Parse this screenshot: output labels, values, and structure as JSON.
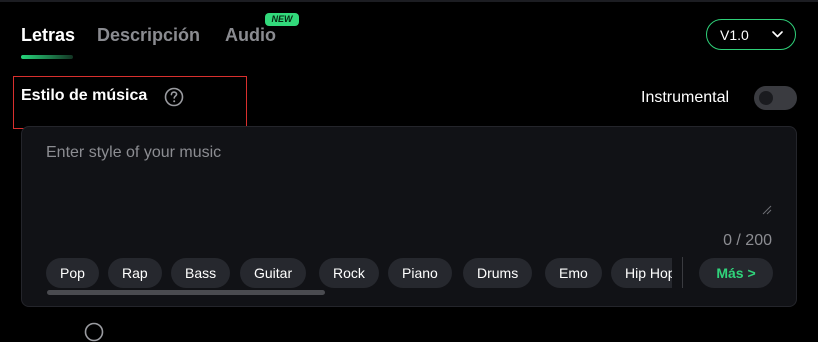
{
  "tabs": [
    {
      "label": "Letras",
      "active": true
    },
    {
      "label": "Descripción",
      "active": false
    },
    {
      "label": "Audio",
      "active": false,
      "badge": "NEW"
    }
  ],
  "version": {
    "label": "V1.0",
    "icon": "chevron-down-icon"
  },
  "music_style": {
    "title": "Estilo de música",
    "help_icon": "question-circle-icon",
    "input_value": "",
    "placeholder": "Enter style of your music",
    "counter": "0 / 200"
  },
  "instrumental": {
    "label": "Instrumental",
    "enabled": false
  },
  "style_tags": [
    "Pop",
    "Rap",
    "Bass",
    "Guitar",
    "Rock",
    "Piano",
    "Drums",
    "Emo",
    "Hip Hop"
  ],
  "more_button": "Más >",
  "colors": {
    "accent": "#2fd079",
    "background": "#000000",
    "panel": "#111216",
    "chip": "#26282e",
    "highlight": "#d9302e"
  }
}
